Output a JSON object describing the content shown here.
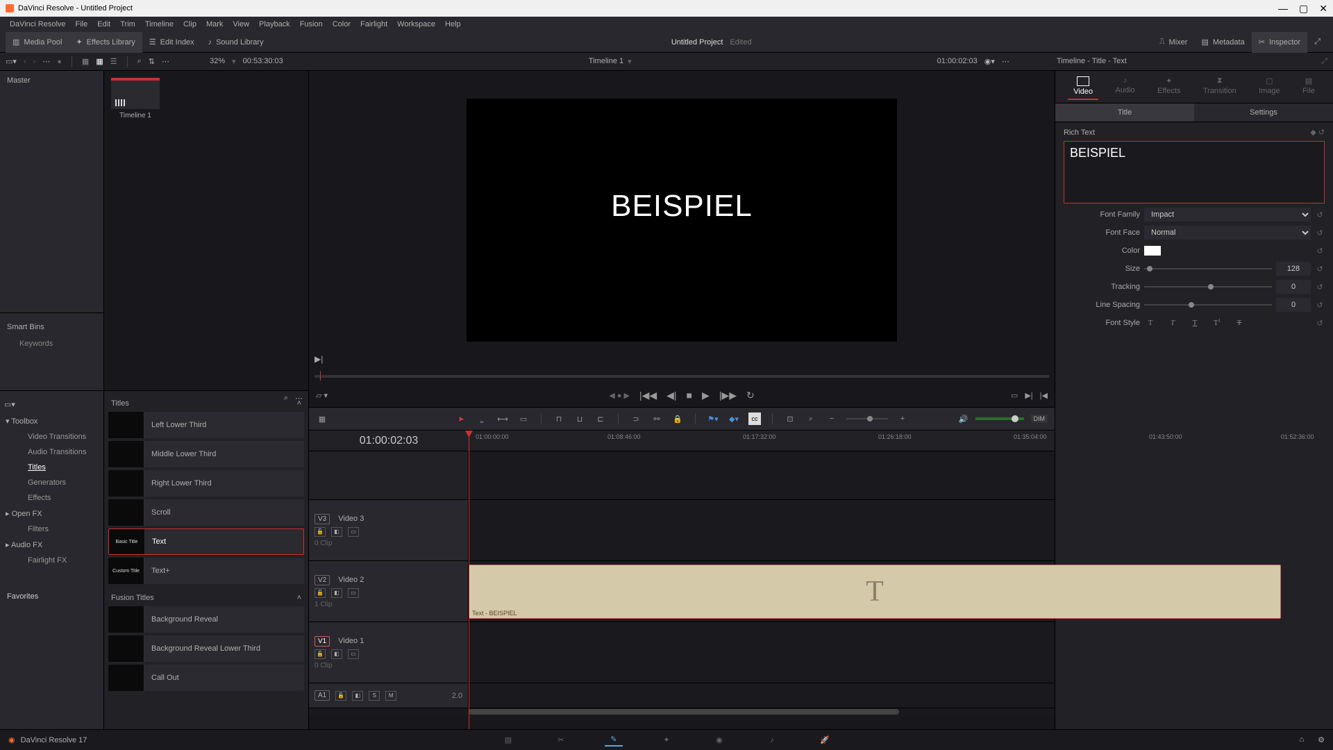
{
  "titlebar": {
    "app": "DaVinci Resolve",
    "project": "Untitled Project"
  },
  "menu": [
    "DaVinci Resolve",
    "File",
    "Edit",
    "Trim",
    "Timeline",
    "Clip",
    "Mark",
    "View",
    "Playback",
    "Fusion",
    "Color",
    "Fairlight",
    "Workspace",
    "Help"
  ],
  "toolbar": {
    "media_pool": "Media Pool",
    "effects_library": "Effects Library",
    "edit_index": "Edit Index",
    "sound_library": "Sound Library",
    "project_title": "Untitled Project",
    "project_status": "Edited",
    "mixer": "Mixer",
    "metadata": "Metadata",
    "inspector": "Inspector"
  },
  "subtoolbar": {
    "zoom": "32%",
    "source_tc": "00:53:30:03",
    "timeline_name": "Timeline 1",
    "record_tc": "01:00:02:03",
    "inspector_breadcrumb": "Timeline - Title - Text"
  },
  "media_pool": {
    "master": "Master",
    "timeline_clip": "Timeline 1",
    "smart_bins_label": "Smart Bins",
    "keywords": "Keywords"
  },
  "effects_tree": {
    "toolbox": "Toolbox",
    "video_transitions": "Video Transitions",
    "audio_transitions": "Audio Transitions",
    "titles": "Titles",
    "generators": "Generators",
    "effects": "Effects",
    "open_fx": "Open FX",
    "filters": "Filters",
    "audio_fx": "Audio FX",
    "fairlight_fx": "Fairlight FX",
    "favorites": "Favorites"
  },
  "titles_list": {
    "header": "Titles",
    "items": [
      {
        "thumb": "",
        "label": "Left Lower Third"
      },
      {
        "thumb": "",
        "label": "Middle Lower Third"
      },
      {
        "thumb": "",
        "label": "Right Lower Third"
      },
      {
        "thumb": "",
        "label": "Scroll"
      },
      {
        "thumb": "Basic Title",
        "label": "Text",
        "selected": true
      },
      {
        "thumb": "Custom Title",
        "label": "Text+"
      }
    ],
    "fusion_header": "Fusion Titles",
    "fusion_items": [
      {
        "label": "Background Reveal"
      },
      {
        "label": "Background Reveal Lower Third"
      },
      {
        "label": "Call Out"
      }
    ]
  },
  "viewer": {
    "title_text": "BEISPIEL"
  },
  "inspector": {
    "tabs": [
      "Video",
      "Audio",
      "Effects",
      "Transition",
      "Image",
      "File"
    ],
    "subtabs": [
      "Title",
      "Settings"
    ],
    "rich_text_label": "Rich Text",
    "text_value": "BEISPIEL",
    "props": {
      "font_family_label": "Font Family",
      "font_family_value": "Impact",
      "font_face_label": "Font Face",
      "font_face_value": "Normal",
      "color_label": "Color",
      "color_value": "#ffffff",
      "size_label": "Size",
      "size_value": "128",
      "tracking_label": "Tracking",
      "tracking_value": "0",
      "line_spacing_label": "Line Spacing",
      "line_spacing_value": "0",
      "font_style_label": "Font Style"
    }
  },
  "timeline": {
    "current_tc": "01:00:02:03",
    "ruler_ticks": [
      "01:00:00:00",
      "01:08:46:00",
      "01:17:32:00",
      "01:26:18:00",
      "01:35:04:00",
      "01:43:50:00",
      "01:52:36:00"
    ],
    "tracks": {
      "v3": {
        "badge": "V3",
        "name": "Video 3",
        "clipcount": "0 Clip"
      },
      "v2": {
        "badge": "V2",
        "name": "Video 2",
        "clipcount": "1 Clip"
      },
      "v1": {
        "badge": "V1",
        "name": "Video 1",
        "clipcount": "0 Clip"
      },
      "a1": {
        "badge": "A1",
        "meter": "2.0"
      }
    },
    "clip_label": "Text - BEISPIEL"
  },
  "bottom": {
    "version": "DaVinci Resolve 17"
  }
}
